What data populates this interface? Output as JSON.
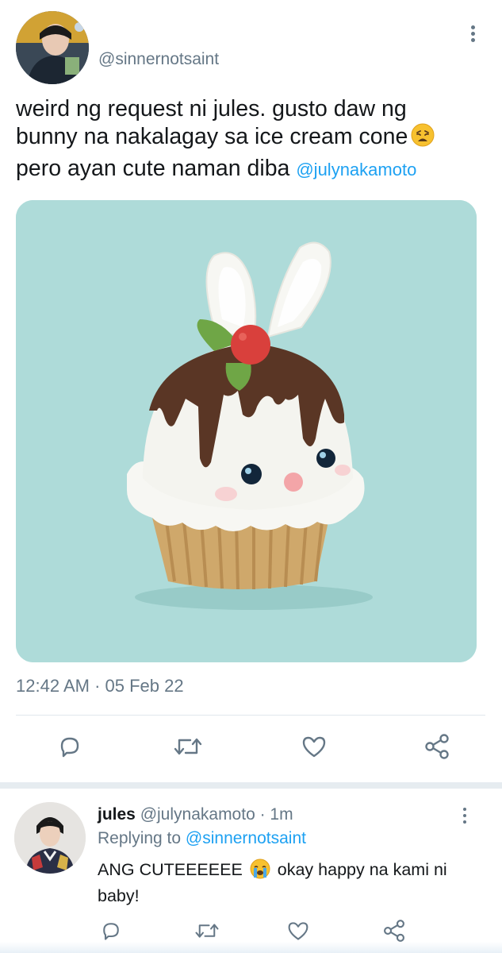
{
  "tweet": {
    "handle": "@sinnernotsaint",
    "text_line1": "weird ng request ni jules. gusto daw ng",
    "text_line2": "bunny na nakalagay sa ice cream cone",
    "text_line3": "pero ayan cute naman diba",
    "mention": "@julynakamoto",
    "emoji": "weary-face-emoji",
    "timestamp": "12:42 AM · 05 Feb 22",
    "media": "crochet-bunny-cupcake-photo",
    "actions": [
      "reply-icon",
      "retweet-icon",
      "like-icon",
      "share-icon"
    ]
  },
  "reply": {
    "name": "jules",
    "handle": "@julynakamoto",
    "time": "· 1m",
    "replying_label": "Replying to",
    "replying_to": "@sinnernotsaint",
    "text_before_emoji": "ANG CUTEEEEEE",
    "text_after_emoji": "okay happy na kami ni baby!",
    "emoji": "crying-face-emoji",
    "actions": [
      "reply-icon",
      "retweet-icon",
      "like-icon",
      "share-icon"
    ]
  },
  "colors": {
    "link": "#1da1f2",
    "muted": "#657786",
    "media_bg": "#aedbd9"
  }
}
